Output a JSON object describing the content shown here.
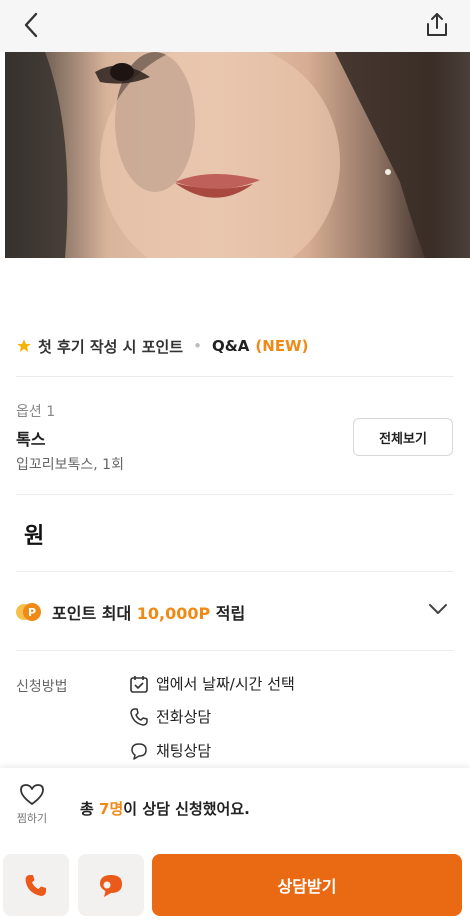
{
  "icons": {
    "back": "chevron-left-icon",
    "share": "share-icon",
    "star": "star-icon",
    "point_coin": "point-coin-icon",
    "chevron": "chevron-down-icon",
    "calendar": "calendar-check-icon",
    "phone": "phone-icon",
    "chat": "chat-bubble-icon",
    "heart": "heart-icon"
  },
  "colors": {
    "accent": "#f08a17",
    "primary_button": "#ea6a14",
    "star": "#f5b400"
  },
  "review": {
    "first_review_text": "첫 후기 작성 시 포인트",
    "separator": "•",
    "qa_label": "Q&A",
    "new_badge": "(NEW)"
  },
  "option": {
    "label": "옵션 1",
    "name": "톡스",
    "desc": "입꼬리보톡스, 1회",
    "view_all": "전체보기"
  },
  "price": {
    "text": "원"
  },
  "points": {
    "prefix": "포인트 최대",
    "amount": "10,000P",
    "suffix": "적립"
  },
  "method": {
    "label": "신청방법",
    "items": [
      {
        "icon": "calendar-check-icon",
        "text": "앱에서 날짜/시간 선택"
      },
      {
        "icon": "phone-icon",
        "text": "전화상담"
      },
      {
        "icon": "chat-bubble-icon",
        "text": "채팅상담"
      }
    ]
  },
  "bottom": {
    "like_label": "찜하기",
    "apply_prefix": "총",
    "apply_count": "7명",
    "apply_suffix": "이 상담 신청했어요.",
    "consult_button": "상담받기"
  }
}
